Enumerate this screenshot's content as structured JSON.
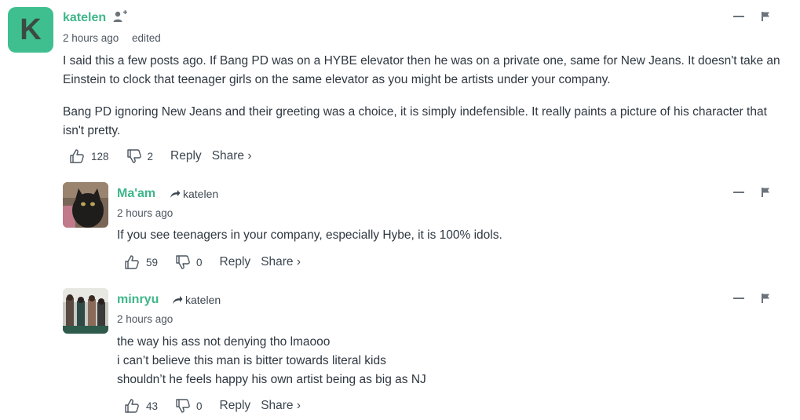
{
  "comments": [
    {
      "author": "katelen",
      "avatar_letter": "K",
      "time": "2 hours ago",
      "edited": "edited",
      "paragraphs": [
        "I said this a few posts ago. If Bang PD was on a HYBE elevator then he was on a private one, same for New Jeans. It doesn't take an Einstein to clock that teenager girls on the same elevator as you might be artists under your company.",
        "Bang PD ignoring New Jeans and their greeting was a choice, it is simply indefensible. It really paints a picture of his character that isn't pretty."
      ],
      "upvotes": "128",
      "downvotes": "2",
      "reply_label": "Reply",
      "share_label": "Share ›"
    },
    {
      "author": "Ma'am",
      "reply_to": "katelen",
      "time": "2 hours ago",
      "lines": [
        "If you see teenagers in your company, especially Hybe, it is 100% idols."
      ],
      "upvotes": "59",
      "downvotes": "0",
      "reply_label": "Reply",
      "share_label": "Share ›"
    },
    {
      "author": "minryu",
      "reply_to": "katelen",
      "time": "2 hours ago",
      "lines": [
        "the way his ass not denying tho lmaooo",
        "i can’t believe this man is bitter towards literal kids",
        "shouldn’t he feels happy his own artist being as big as NJ"
      ],
      "upvotes": "43",
      "downvotes": "0",
      "reply_label": "Reply",
      "share_label": "Share ›"
    }
  ],
  "colors": {
    "accent": "#3fb68a",
    "avatar_bg": "#3fbf8f",
    "text": "#2e3740",
    "muted": "#4d5660"
  },
  "icons": [
    "follow-user-icon",
    "reply-arrow-icon",
    "thumbs-up-icon",
    "thumbs-down-icon",
    "collapse-icon",
    "flag-icon"
  ]
}
